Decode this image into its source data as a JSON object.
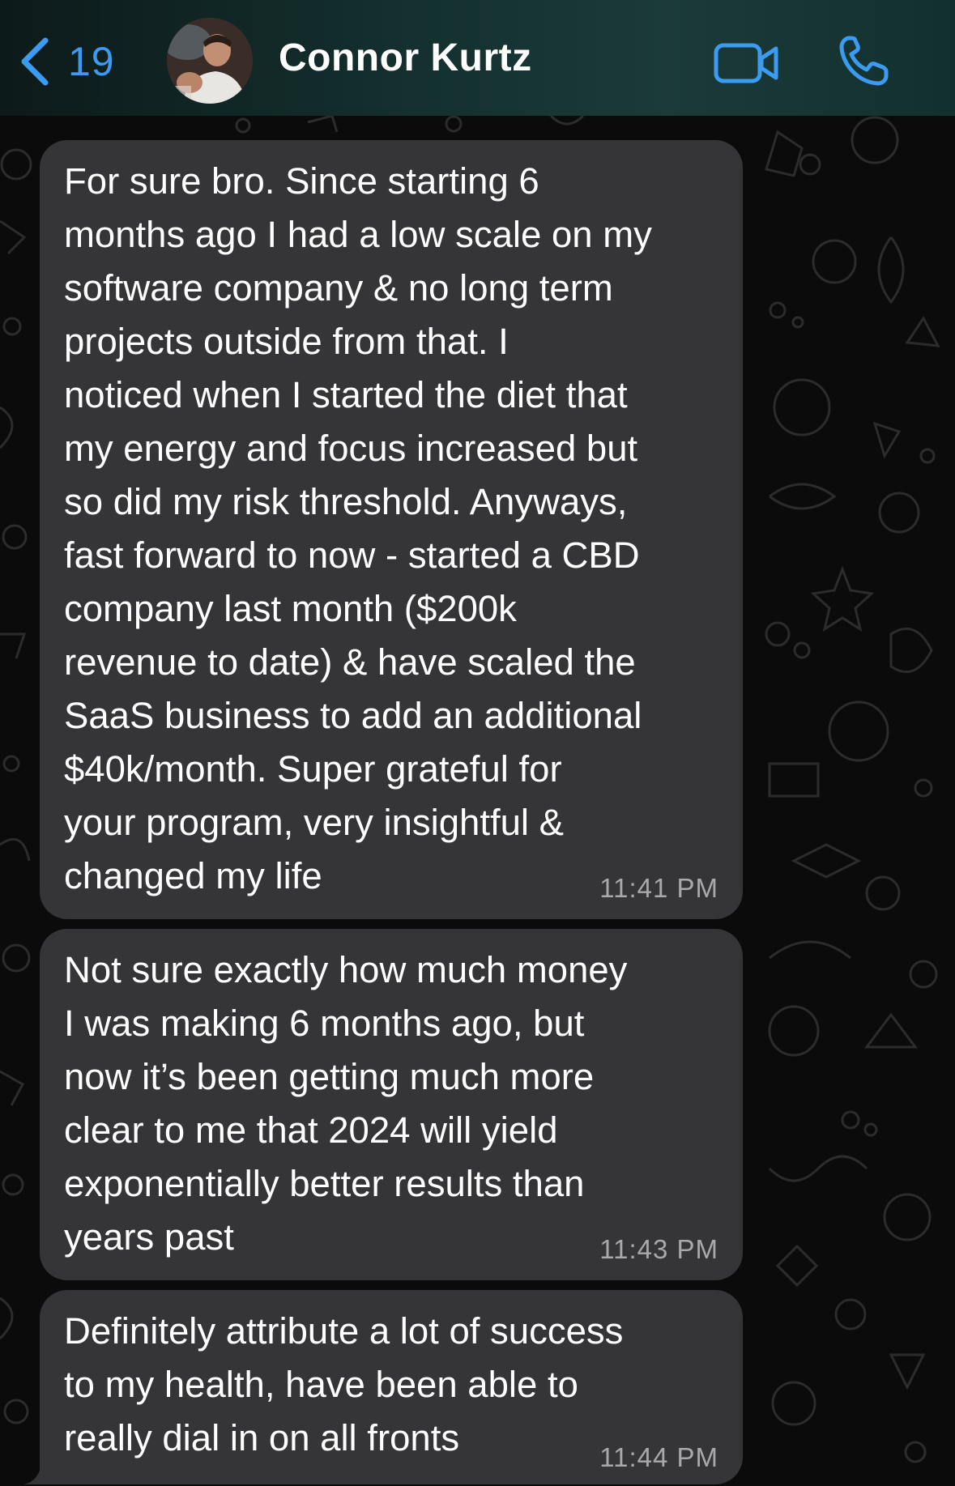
{
  "header": {
    "back_count": "19",
    "contact_name": "Connor Kurtz",
    "back_icon": "chevron-left-icon",
    "video_icon": "video-camera-icon",
    "call_icon": "phone-icon",
    "accent_color": "#3b9bf0"
  },
  "messages": [
    {
      "text": "For sure bro. Since starting 6\nmonths ago I had a low scale on my\nsoftware company & no long term\nprojects outside from that. I\nnoticed when I started the diet that\nmy energy and focus increased but\nso did my risk threshold. Anyways,\nfast forward to now - started a CBD\ncompany last month ($200k\nrevenue to date) & have scaled the\nSaaS business to add an additional\n$40k/month. Super grateful for\nyour program, very insightful &\nchanged my life",
      "time": "11:41 PM"
    },
    {
      "text": "Not sure exactly how much money\nI was making 6 months ago, but\nnow it’s been getting much more\nclear to me that 2024 will yield\nexponentially better results than\nyears past",
      "time": "11:43 PM"
    },
    {
      "text": "Definitely attribute a lot of success\nto my health, have been able to\nreally dial in on all fronts",
      "time": "11:44 PM"
    }
  ]
}
